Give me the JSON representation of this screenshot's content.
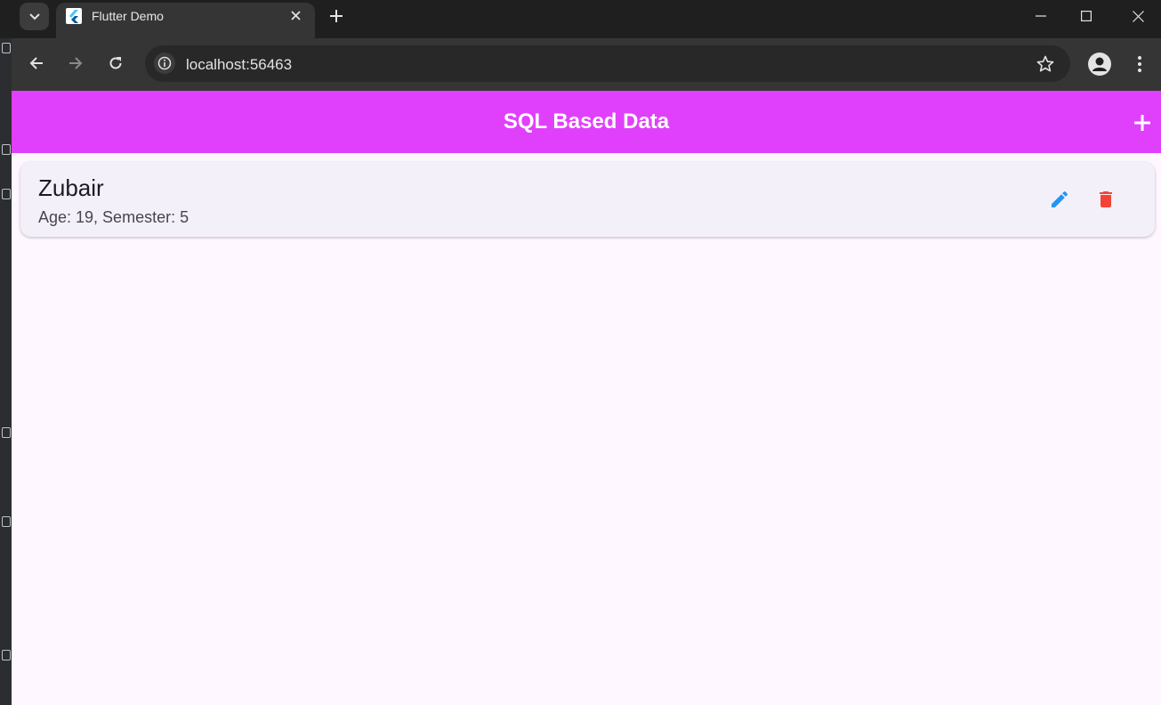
{
  "browser": {
    "tab_title": "Flutter Demo",
    "url": "localhost:56463",
    "icons": {
      "tab_search": "chevron-down-icon",
      "favicon": "flutter-icon",
      "tab_close": "close-icon",
      "new_tab": "plus-icon",
      "back": "arrow-left-icon",
      "forward": "arrow-right-icon",
      "reload": "reload-icon",
      "site_info": "info-icon",
      "bookmark": "star-icon",
      "profile": "person-icon",
      "menu": "kebab-icon",
      "minimize": "minimize-icon",
      "maximize": "maximize-icon",
      "close_window": "close-icon"
    }
  },
  "app": {
    "title": "SQL Based Data",
    "colors": {
      "appbar": "#e040fb",
      "edit": "#2196f3",
      "delete": "#f44336",
      "background": "#fef7ff"
    },
    "students": [
      {
        "name": "Zubair",
        "details": "Age: 19, Semester: 5"
      }
    ]
  }
}
